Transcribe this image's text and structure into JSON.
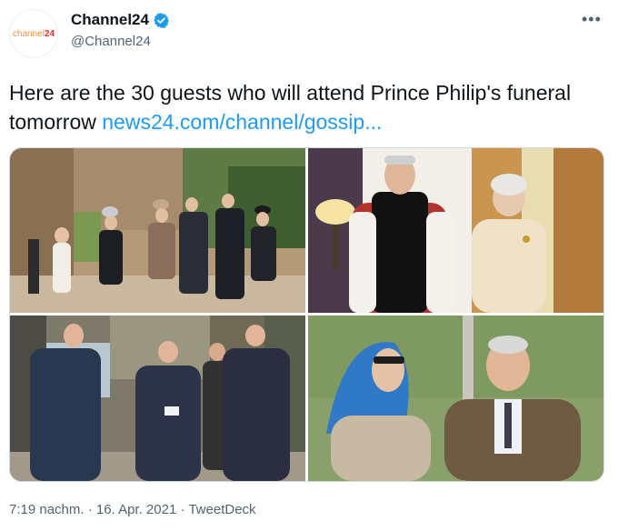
{
  "account": {
    "display_name": "Channel24",
    "handle": "@Channel24",
    "logo_text_a": "channel",
    "logo_text_b": "24",
    "verified": true
  },
  "tweet": {
    "text": "Here are the 30 guests who will attend Prince Philip's funeral tomorrow ",
    "link": "news24.com/channel/gossip...",
    "timestamp": "7:19 nachm. · 16. Apr. 2021 · TweetDeck"
  },
  "more_icon": "more-horizontal-icon",
  "colors": {
    "link": "#1d9bf0",
    "verified": "#1d9bf0",
    "muted": "#536471"
  }
}
